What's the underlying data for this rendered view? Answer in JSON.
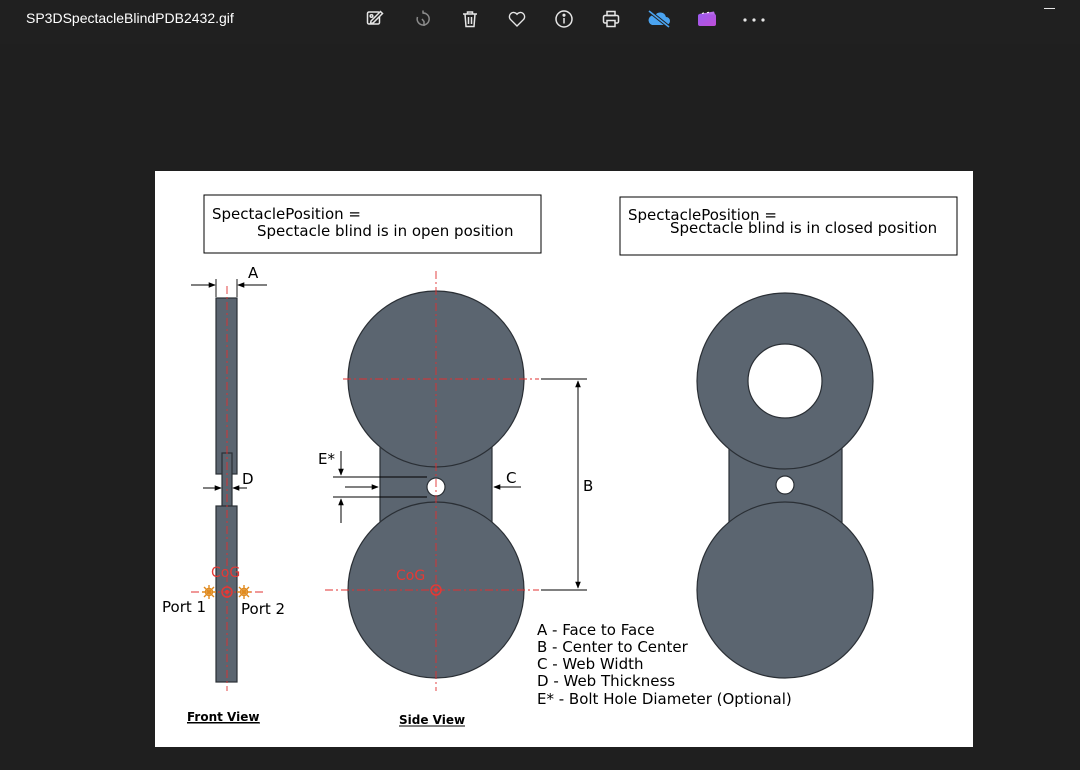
{
  "window": {
    "title": "SP3DSpectacleBlindPDB2432.gif"
  },
  "toolbar": [
    {
      "name": "edit-image-icon"
    },
    {
      "name": "rotate-icon"
    },
    {
      "name": "delete-icon"
    },
    {
      "name": "favorite-heart-icon"
    },
    {
      "name": "info-icon"
    },
    {
      "name": "print-icon"
    },
    {
      "name": "onedrive-offline-icon"
    },
    {
      "name": "clipchamp-video-icon"
    },
    {
      "name": "more-options-icon"
    }
  ],
  "drawing": {
    "box_open": {
      "line1": "SpectaclePosition =",
      "line2": "Spectacle blind is in open position"
    },
    "box_closed": {
      "line1": "SpectaclePosition =",
      "line2": "Spectacle blind is in closed position"
    },
    "dims": {
      "a": "A",
      "b": "B",
      "c": "C",
      "d": "D",
      "e": "E*"
    },
    "cog_front": "CoG",
    "cog_side": "CoG",
    "port1": "Port 1",
    "port2": "Port 2",
    "legend": [
      "A - Face to Face",
      "B - Center to Center",
      "C - Web Width",
      "D - Web Thickness",
      "E* - Bolt Hole Diameter (Optional)"
    ],
    "front_view_label": "Front View",
    "side_view_label": "Side View",
    "colors": {
      "part_fill": "#5b6570",
      "part_stroke": "#2a2f35",
      "center_line": "#e03030",
      "cog_text": "#e53935",
      "port_marker": "#e08a1e"
    }
  }
}
